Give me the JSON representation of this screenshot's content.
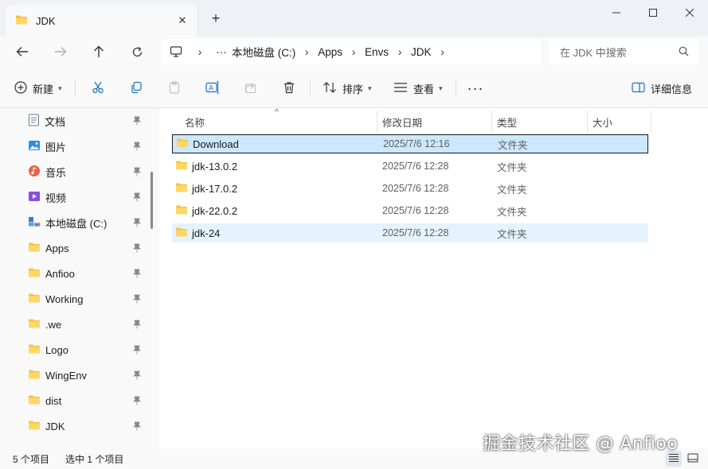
{
  "window": {
    "tab_title": "JDK",
    "tab_close_icon": "close-icon",
    "new_tab_icon": "plus-icon"
  },
  "address": {
    "crumbs": [
      "本地磁盘 (C:)",
      "Apps",
      "Envs",
      "JDK"
    ],
    "search_placeholder": "在 JDK 中搜索"
  },
  "toolbar": {
    "new_label": "新建",
    "sort_label": "排序",
    "view_label": "查看",
    "details_label": "详细信息"
  },
  "sidebar": {
    "items": [
      {
        "label": "文档",
        "icon": "documents-icon"
      },
      {
        "label": "图片",
        "icon": "pictures-icon"
      },
      {
        "label": "音乐",
        "icon": "music-icon"
      },
      {
        "label": "视频",
        "icon": "videos-icon"
      },
      {
        "label": "本地磁盘 (C:)",
        "icon": "drive-icon"
      },
      {
        "label": "Apps",
        "icon": "folder-icon"
      },
      {
        "label": "Anfioo",
        "icon": "folder-icon"
      },
      {
        "label": "Working",
        "icon": "folder-icon"
      },
      {
        "label": ".we",
        "icon": "folder-icon"
      },
      {
        "label": "Logo",
        "icon": "folder-icon"
      },
      {
        "label": "WingEnv",
        "icon": "folder-icon"
      },
      {
        "label": "dist",
        "icon": "folder-icon"
      },
      {
        "label": "JDK",
        "icon": "folder-icon"
      }
    ]
  },
  "list": {
    "columns": {
      "name": "名称",
      "date": "修改日期",
      "type": "类型",
      "size": "大小"
    },
    "rows": [
      {
        "name": "Download",
        "date": "2025/7/6 12:16",
        "type": "文件夹",
        "state": "selected"
      },
      {
        "name": "jdk-13.0.2",
        "date": "2025/7/6 12:28",
        "type": "文件夹",
        "state": "normal"
      },
      {
        "name": "jdk-17.0.2",
        "date": "2025/7/6 12:28",
        "type": "文件夹",
        "state": "normal"
      },
      {
        "name": "jdk-22.0.2",
        "date": "2025/7/6 12:28",
        "type": "文件夹",
        "state": "normal"
      },
      {
        "name": "jdk-24",
        "date": "2025/7/6 12:28",
        "type": "文件夹",
        "state": "hover"
      }
    ]
  },
  "status": {
    "item_count": "5 个项目",
    "selection": "选中 1 个项目"
  },
  "watermark": "掘金技术社区 @ Anfioo",
  "colors": {
    "folder": "#f5c342",
    "selected_row": "#cce8ff",
    "hover_row": "#e5f3ff"
  }
}
